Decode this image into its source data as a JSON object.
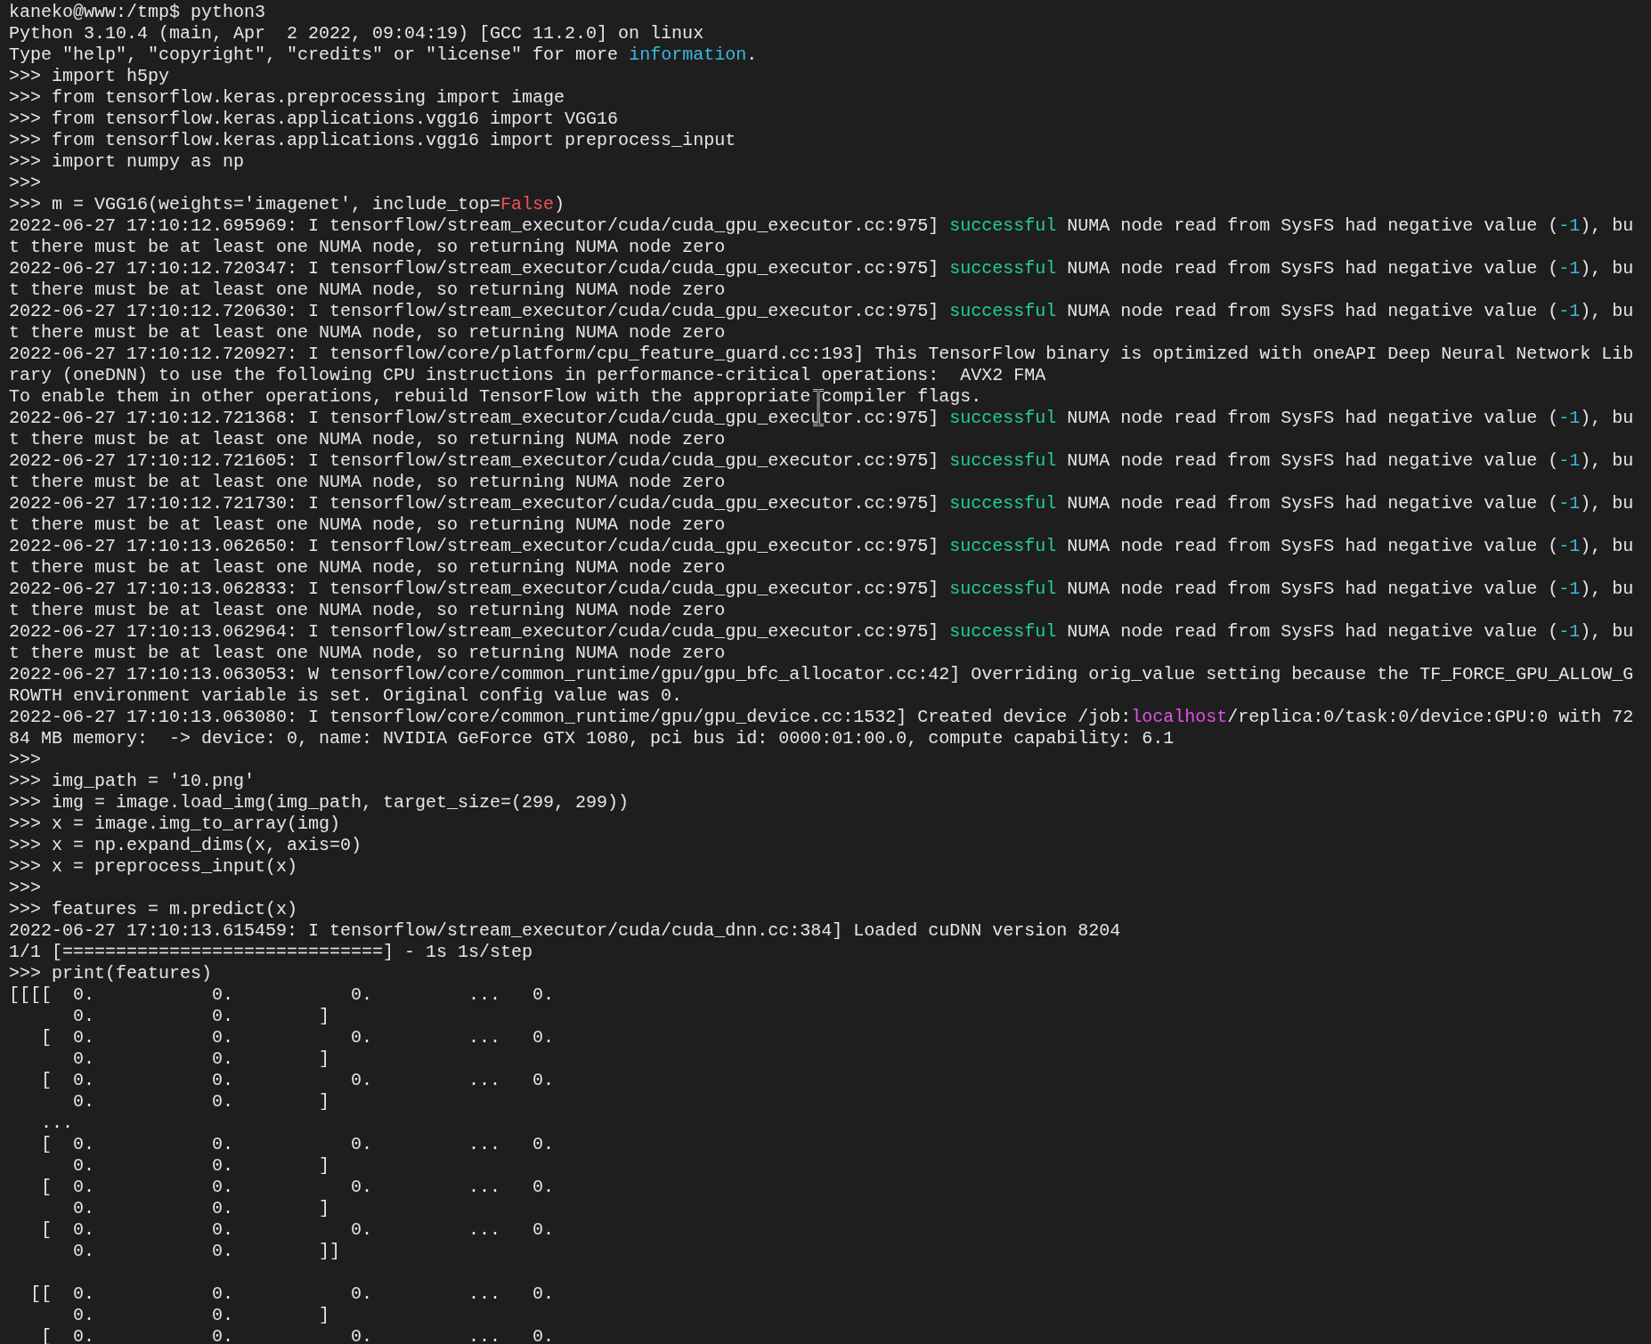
{
  "terminal": {
    "lines": [
      {
        "kind": "text",
        "parts": [
          {
            "text": "kaneko@www:/tmp$ python3",
            "kind": "plain"
          }
        ]
      },
      {
        "kind": "text",
        "parts": [
          {
            "text": "Python 3.10.4 (main, Apr  2 2022, 09:04:19) [GCC 11.2.0] on linux",
            "kind": "plain"
          }
        ]
      },
      {
        "kind": "text",
        "parts": [
          {
            "text": "Type \"help\", \"copyright\", \"credits\" or \"license\" for more ",
            "kind": "plain"
          },
          {
            "text": "information",
            "kind": "info"
          },
          {
            "text": ".",
            "kind": "plain"
          }
        ]
      },
      {
        "kind": "text",
        "parts": [
          {
            "text": ">>> import h5py",
            "kind": "plain"
          }
        ]
      },
      {
        "kind": "text",
        "parts": [
          {
            "text": ">>> from tensorflow.keras.preprocessing import image",
            "kind": "plain"
          }
        ]
      },
      {
        "kind": "text",
        "parts": [
          {
            "text": ">>> from tensorflow.keras.applications.vgg16 import VGG16",
            "kind": "plain"
          }
        ]
      },
      {
        "kind": "text",
        "parts": [
          {
            "text": ">>> from tensorflow.keras.applications.vgg16 import preprocess_input",
            "kind": "plain"
          }
        ]
      },
      {
        "kind": "text",
        "parts": [
          {
            "text": ">>> import numpy as np",
            "kind": "plain"
          }
        ]
      },
      {
        "kind": "text",
        "parts": [
          {
            "text": ">>>",
            "kind": "plain"
          }
        ]
      },
      {
        "kind": "text",
        "parts": [
          {
            "text": ">>> m = VGG16(weights='imagenet', include_top=",
            "kind": "plain"
          },
          {
            "text": "False",
            "kind": "keyword"
          },
          {
            "text": ")",
            "kind": "plain"
          }
        ]
      },
      {
        "kind": "text",
        "parts": [
          {
            "text": "2022-06-27 17:10:12.695969: I tensorflow/stream_executor/cuda/cuda_gpu_executor.cc:975] ",
            "kind": "plain"
          },
          {
            "text": "successful",
            "kind": "success"
          },
          {
            "text": " NUMA node read from SysFS had negative value (",
            "kind": "plain"
          },
          {
            "text": "-1",
            "kind": "info"
          },
          {
            "text": "), bu",
            "kind": "plain"
          }
        ]
      },
      {
        "kind": "text",
        "parts": [
          {
            "text": "t there must be at least one NUMA node, so returning NUMA node zero",
            "kind": "plain"
          }
        ]
      },
      {
        "kind": "text",
        "parts": [
          {
            "text": "2022-06-27 17:10:12.720347: I tensorflow/stream_executor/cuda/cuda_gpu_executor.cc:975] ",
            "kind": "plain"
          },
          {
            "text": "successful",
            "kind": "success"
          },
          {
            "text": " NUMA node read from SysFS had negative value (",
            "kind": "plain"
          },
          {
            "text": "-1",
            "kind": "info"
          },
          {
            "text": "), bu",
            "kind": "plain"
          }
        ]
      },
      {
        "kind": "text",
        "parts": [
          {
            "text": "t there must be at least one NUMA node, so returning NUMA node zero",
            "kind": "plain"
          }
        ]
      },
      {
        "kind": "text",
        "parts": [
          {
            "text": "2022-06-27 17:10:12.720630: I tensorflow/stream_executor/cuda/cuda_gpu_executor.cc:975] ",
            "kind": "plain"
          },
          {
            "text": "successful",
            "kind": "success"
          },
          {
            "text": " NUMA node read from SysFS had negative value (",
            "kind": "plain"
          },
          {
            "text": "-1",
            "kind": "info"
          },
          {
            "text": "), bu",
            "kind": "plain"
          }
        ]
      },
      {
        "kind": "text",
        "parts": [
          {
            "text": "t there must be at least one NUMA node, so returning NUMA node zero",
            "kind": "plain"
          }
        ]
      },
      {
        "kind": "text",
        "parts": [
          {
            "text": "2022-06-27 17:10:12.720927: I tensorflow/core/platform/cpu_feature_guard.cc:193] This TensorFlow binary is optimized with oneAPI Deep Neural Network Lib",
            "kind": "plain"
          }
        ]
      },
      {
        "kind": "text",
        "parts": [
          {
            "text": "rary (oneDNN) to use the following CPU instructions in performance-critical operations:  AVX2 FMA",
            "kind": "plain"
          }
        ]
      },
      {
        "kind": "text",
        "parts": [
          {
            "text": "To enable them in other operations, rebuild TensorFlow with the appropriate compiler flags.",
            "kind": "plain"
          }
        ]
      },
      {
        "kind": "text",
        "parts": [
          {
            "text": "2022-06-27 17:10:12.721368: I tensorflow/stream_executor/cuda/cuda_gpu_executor.cc:975] ",
            "kind": "plain"
          },
          {
            "text": "successful",
            "kind": "success"
          },
          {
            "text": " NUMA node read from SysFS had negative value (",
            "kind": "plain"
          },
          {
            "text": "-1",
            "kind": "info"
          },
          {
            "text": "), bu",
            "kind": "plain"
          }
        ]
      },
      {
        "kind": "text",
        "parts": [
          {
            "text": "t there must be at least one NUMA node, so returning NUMA node zero",
            "kind": "plain"
          }
        ]
      },
      {
        "kind": "text",
        "parts": [
          {
            "text": "2022-06-27 17:10:12.721605: I tensorflow/stream_executor/cuda/cuda_gpu_executor.cc:975] ",
            "kind": "plain"
          },
          {
            "text": "successful",
            "kind": "success"
          },
          {
            "text": " NUMA node read from SysFS had negative value (",
            "kind": "plain"
          },
          {
            "text": "-1",
            "kind": "info"
          },
          {
            "text": "), bu",
            "kind": "plain"
          }
        ]
      },
      {
        "kind": "text",
        "parts": [
          {
            "text": "t there must be at least one NUMA node, so returning NUMA node zero",
            "kind": "plain"
          }
        ]
      },
      {
        "kind": "text",
        "parts": [
          {
            "text": "2022-06-27 17:10:12.721730: I tensorflow/stream_executor/cuda/cuda_gpu_executor.cc:975] ",
            "kind": "plain"
          },
          {
            "text": "successful",
            "kind": "success"
          },
          {
            "text": " NUMA node read from SysFS had negative value (",
            "kind": "plain"
          },
          {
            "text": "-1",
            "kind": "info"
          },
          {
            "text": "), bu",
            "kind": "plain"
          }
        ]
      },
      {
        "kind": "text",
        "parts": [
          {
            "text": "t there must be at least one NUMA node, so returning NUMA node zero",
            "kind": "plain"
          }
        ]
      },
      {
        "kind": "text",
        "parts": [
          {
            "text": "2022-06-27 17:10:13.062650: I tensorflow/stream_executor/cuda/cuda_gpu_executor.cc:975] ",
            "kind": "plain"
          },
          {
            "text": "successful",
            "kind": "success"
          },
          {
            "text": " NUMA node read from SysFS had negative value (",
            "kind": "plain"
          },
          {
            "text": "-1",
            "kind": "info"
          },
          {
            "text": "), bu",
            "kind": "plain"
          }
        ]
      },
      {
        "kind": "text",
        "parts": [
          {
            "text": "t there must be at least one NUMA node, so returning NUMA node zero",
            "kind": "plain"
          }
        ]
      },
      {
        "kind": "text",
        "parts": [
          {
            "text": "2022-06-27 17:10:13.062833: I tensorflow/stream_executor/cuda/cuda_gpu_executor.cc:975] ",
            "kind": "plain"
          },
          {
            "text": "successful",
            "kind": "success"
          },
          {
            "text": " NUMA node read from SysFS had negative value (",
            "kind": "plain"
          },
          {
            "text": "-1",
            "kind": "info"
          },
          {
            "text": "), bu",
            "kind": "plain"
          }
        ]
      },
      {
        "kind": "text",
        "parts": [
          {
            "text": "t there must be at least one NUMA node, so returning NUMA node zero",
            "kind": "plain"
          }
        ]
      },
      {
        "kind": "text",
        "parts": [
          {
            "text": "2022-06-27 17:10:13.062964: I tensorflow/stream_executor/cuda/cuda_gpu_executor.cc:975] ",
            "kind": "plain"
          },
          {
            "text": "successful",
            "kind": "success"
          },
          {
            "text": " NUMA node read from SysFS had negative value (",
            "kind": "plain"
          },
          {
            "text": "-1",
            "kind": "info"
          },
          {
            "text": "), bu",
            "kind": "plain"
          }
        ]
      },
      {
        "kind": "text",
        "parts": [
          {
            "text": "t there must be at least one NUMA node, so returning NUMA node zero",
            "kind": "plain"
          }
        ]
      },
      {
        "kind": "text",
        "parts": [
          {
            "text": "2022-06-27 17:10:13.063053: W tensorflow/core/common_runtime/gpu/gpu_bfc_allocator.cc:42] Overriding orig_value setting because the TF_FORCE_GPU_ALLOW_G",
            "kind": "plain"
          }
        ]
      },
      {
        "kind": "text",
        "parts": [
          {
            "text": "ROWTH environment variable is set. Original config value was 0.",
            "kind": "plain"
          }
        ]
      },
      {
        "kind": "text",
        "parts": [
          {
            "text": "2022-06-27 17:10:13.063080: I tensorflow/core/common_runtime/gpu/gpu_device.cc:1532] Created device /job:",
            "kind": "plain"
          },
          {
            "text": "localhost",
            "kind": "host"
          },
          {
            "text": "/replica:0/task:0/device:GPU:0 with 72",
            "kind": "plain"
          }
        ]
      },
      {
        "kind": "text",
        "parts": [
          {
            "text": "84 MB memory:  -> device: 0, name: NVIDIA GeForce GTX 1080, pci bus id: 0000:01:00.0, compute capability: 6.1",
            "kind": "plain"
          }
        ]
      },
      {
        "kind": "text",
        "parts": [
          {
            "text": ">>>",
            "kind": "plain"
          }
        ]
      },
      {
        "kind": "text",
        "parts": [
          {
            "text": ">>> img_path = '10.png'",
            "kind": "plain"
          }
        ]
      },
      {
        "kind": "text",
        "parts": [
          {
            "text": ">>> img = image.load_img(img_path, target_size=(299, 299))",
            "kind": "plain"
          }
        ]
      },
      {
        "kind": "text",
        "parts": [
          {
            "text": ">>> x = image.img_to_array(img)",
            "kind": "plain"
          }
        ]
      },
      {
        "kind": "text",
        "parts": [
          {
            "text": ">>> x = np.expand_dims(x, axis=0)",
            "kind": "plain"
          }
        ]
      },
      {
        "kind": "text",
        "parts": [
          {
            "text": ">>> x = preprocess_input(x)",
            "kind": "plain"
          }
        ]
      },
      {
        "kind": "text",
        "parts": [
          {
            "text": ">>>",
            "kind": "plain"
          }
        ]
      },
      {
        "kind": "text",
        "parts": [
          {
            "text": ">>> features = m.predict(x)",
            "kind": "plain"
          }
        ]
      },
      {
        "kind": "text",
        "parts": [
          {
            "text": "2022-06-27 17:10:13.615459: I tensorflow/stream_executor/cuda/cuda_dnn.cc:384] Loaded cuDNN version 8204",
            "kind": "plain"
          }
        ]
      },
      {
        "kind": "text",
        "parts": [
          {
            "text": "1/1 [==============================] - 1s 1s/step",
            "kind": "plain"
          }
        ]
      },
      {
        "kind": "text",
        "parts": [
          {
            "text": ">>> print(features)",
            "kind": "plain"
          }
        ]
      },
      {
        "kind": "text",
        "parts": [
          {
            "text": "[[[[  0.           0.           0.         ...   0.",
            "kind": "plain"
          }
        ]
      },
      {
        "kind": "text",
        "parts": [
          {
            "text": "      0.           0.        ]",
            "kind": "plain"
          }
        ]
      },
      {
        "kind": "text",
        "parts": [
          {
            "text": "   [  0.           0.           0.         ...   0.",
            "kind": "plain"
          }
        ]
      },
      {
        "kind": "text",
        "parts": [
          {
            "text": "      0.           0.        ]",
            "kind": "plain"
          }
        ]
      },
      {
        "kind": "text",
        "parts": [
          {
            "text": "   [  0.           0.           0.         ...   0.",
            "kind": "plain"
          }
        ]
      },
      {
        "kind": "text",
        "parts": [
          {
            "text": "      0.           0.        ]",
            "kind": "plain"
          }
        ]
      },
      {
        "kind": "text",
        "parts": [
          {
            "text": "   ...",
            "kind": "plain"
          }
        ]
      },
      {
        "kind": "text",
        "parts": [
          {
            "text": "   [  0.           0.           0.         ...   0.",
            "kind": "plain"
          }
        ]
      },
      {
        "kind": "text",
        "parts": [
          {
            "text": "      0.           0.        ]",
            "kind": "plain"
          }
        ]
      },
      {
        "kind": "text",
        "parts": [
          {
            "text": "   [  0.           0.           0.         ...   0.",
            "kind": "plain"
          }
        ]
      },
      {
        "kind": "text",
        "parts": [
          {
            "text": "      0.           0.        ]",
            "kind": "plain"
          }
        ]
      },
      {
        "kind": "text",
        "parts": [
          {
            "text": "   [  0.           0.           0.         ...   0.",
            "kind": "plain"
          }
        ]
      },
      {
        "kind": "text",
        "parts": [
          {
            "text": "      0.           0.        ]]",
            "kind": "plain"
          }
        ]
      },
      {
        "kind": "blank"
      },
      {
        "kind": "text",
        "parts": [
          {
            "text": "  [[  0.           0.           0.         ...   0.",
            "kind": "plain"
          }
        ]
      },
      {
        "kind": "text",
        "parts": [
          {
            "text": "      0.           0.        ]",
            "kind": "plain"
          }
        ]
      },
      {
        "kind": "text",
        "parts": [
          {
            "text": "   [  0.           0.           0.         ...   0.",
            "kind": "plain"
          }
        ]
      }
    ]
  }
}
